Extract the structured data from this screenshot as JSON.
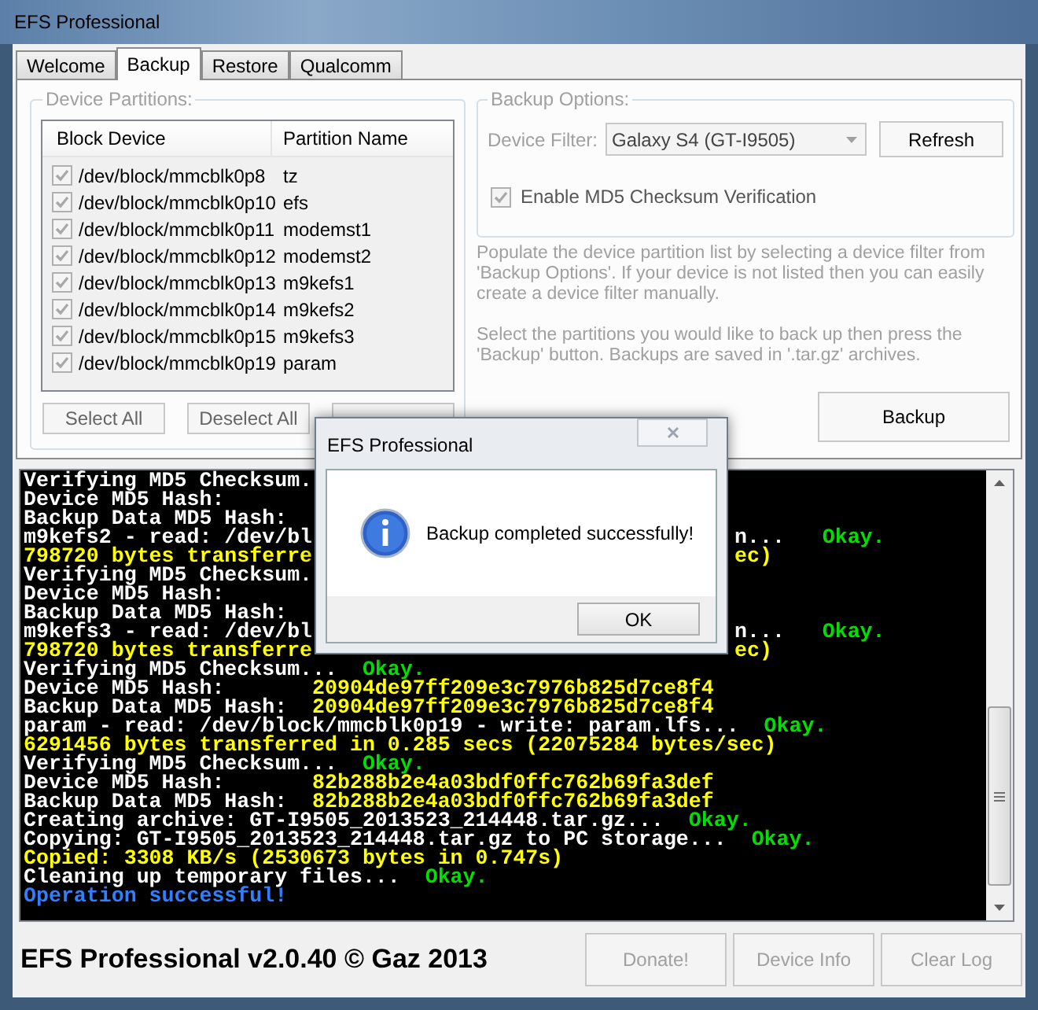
{
  "window": {
    "title": "EFS Professional"
  },
  "tabs": [
    {
      "label": "Welcome",
      "selected": false
    },
    {
      "label": "Backup",
      "selected": true
    },
    {
      "label": "Restore",
      "selected": false
    },
    {
      "label": "Qualcomm",
      "selected": false
    }
  ],
  "partitions": {
    "title": "Device Partitions:",
    "columns": [
      "Block Device",
      "Partition Name"
    ],
    "rows": [
      {
        "device": "/dev/block/mmcblk0p8",
        "name": "tz",
        "checked": true
      },
      {
        "device": "/dev/block/mmcblk0p10",
        "name": "efs",
        "checked": true
      },
      {
        "device": "/dev/block/mmcblk0p11",
        "name": "modemst1",
        "checked": true
      },
      {
        "device": "/dev/block/mmcblk0p12",
        "name": "modemst2",
        "checked": true
      },
      {
        "device": "/dev/block/mmcblk0p13",
        "name": "m9kefs1",
        "checked": true
      },
      {
        "device": "/dev/block/mmcblk0p14",
        "name": "m9kefs2",
        "checked": true
      },
      {
        "device": "/dev/block/mmcblk0p15",
        "name": "m9kefs3",
        "checked": true
      },
      {
        "device": "/dev/block/mmcblk0p19",
        "name": "param",
        "checked": true
      }
    ],
    "buttons": [
      "Select All",
      "Deselect All"
    ]
  },
  "backup_options": {
    "title": "Backup Options:",
    "filter_label": "Device Filter:",
    "filter_value": "Galaxy S4 (GT-I9505)",
    "refresh": "Refresh",
    "md5": {
      "label": "Enable MD5 Checksum Verification",
      "checked": true,
      "disabled": true
    }
  },
  "help": [
    "Populate the device partition list by selecting a device filter from 'Backup Options'. If your device is not listed then you can easily create a device filter manually.",
    "Select the partitions you would like to back up then press the 'Backup' button. Backups are saved in '.tar.gz' archives."
  ],
  "backup_button": "Backup",
  "log": [
    {
      "segments": [
        {
          "text": "Verifying MD5 Checksum.",
          "color": "#ffffff"
        }
      ]
    },
    {
      "segments": [
        {
          "text": "Device MD5 Hash:",
          "color": "#ffffff"
        }
      ]
    },
    {
      "segments": [
        {
          "text": "Backup Data MD5 Hash:",
          "color": "#ffffff"
        }
      ]
    },
    {
      "segments": [
        {
          "text": "m9kefs2 - read: /dev/bl",
          "color": "#ffffff"
        }
      ],
      "tail": [
        {
          "text": "n...   ",
          "color": "#ffffff"
        },
        {
          "text": "Okay.",
          "color": "#00e000"
        }
      ]
    },
    {
      "segments": [
        {
          "text": "798720 bytes transferre",
          "color": "#ffff00"
        }
      ],
      "tail": [
        {
          "text": "ec)",
          "color": "#ffff00"
        }
      ]
    },
    {
      "segments": [
        {
          "text": "Verifying MD5 Checksum.",
          "color": "#ffffff"
        }
      ]
    },
    {
      "segments": [
        {
          "text": "Device MD5 Hash:",
          "color": "#ffffff"
        }
      ]
    },
    {
      "segments": [
        {
          "text": "Backup Data MD5 Hash:",
          "color": "#ffffff"
        }
      ]
    },
    {
      "segments": [
        {
          "text": "m9kefs3 - read: /dev/bl",
          "color": "#ffffff"
        }
      ],
      "tail": [
        {
          "text": "n...   ",
          "color": "#ffffff"
        },
        {
          "text": "Okay.",
          "color": "#00e000"
        }
      ]
    },
    {
      "segments": [
        {
          "text": "798720 bytes transferre",
          "color": "#ffff00"
        }
      ],
      "tail": [
        {
          "text": "ec)",
          "color": "#ffff00"
        }
      ]
    },
    {
      "segments": [
        {
          "text": "Verifying MD5 Checksum...  ",
          "color": "#ffffff"
        },
        {
          "text": "Okay.",
          "color": "#00e000"
        }
      ]
    },
    {
      "segments": [
        {
          "text": "Device MD5 Hash:       ",
          "color": "#ffffff"
        },
        {
          "text": "20904de97ff209e3c7976b825d7ce8f4",
          "color": "#ffff00"
        }
      ]
    },
    {
      "segments": [
        {
          "text": "Backup Data MD5 Hash:  ",
          "color": "#ffffff"
        },
        {
          "text": "20904de97ff209e3c7976b825d7ce8f4",
          "color": "#ffff00"
        }
      ]
    },
    {
      "segments": [
        {
          "text": "param - read: /dev/block/mmcblk0p19 - write: param.lfs...  ",
          "color": "#ffffff"
        },
        {
          "text": "Okay.",
          "color": "#00e000"
        }
      ]
    },
    {
      "segments": [
        {
          "text": "6291456 bytes transferred in 0.285 secs (22075284 bytes/sec)",
          "color": "#ffff00"
        }
      ]
    },
    {
      "segments": [
        {
          "text": "Verifying MD5 Checksum...  ",
          "color": "#ffffff"
        },
        {
          "text": "Okay.",
          "color": "#00e000"
        }
      ]
    },
    {
      "segments": [
        {
          "text": "Device MD5 Hash:       ",
          "color": "#ffffff"
        },
        {
          "text": "82b288b2e4a03bdf0ffc762b69fa3def",
          "color": "#ffff00"
        }
      ]
    },
    {
      "segments": [
        {
          "text": "Backup Data MD5 Hash:  ",
          "color": "#ffffff"
        },
        {
          "text": "82b288b2e4a03bdf0ffc762b69fa3def",
          "color": "#ffff00"
        }
      ]
    },
    {
      "segments": [
        {
          "text": "Creating archive: GT-I9505_2013523_214448.tar.gz...  ",
          "color": "#ffffff"
        },
        {
          "text": "Okay.",
          "color": "#00e000"
        }
      ]
    },
    {
      "segments": [
        {
          "text": "Copying: GT-I9505_2013523_214448.tar.gz to PC storage...  ",
          "color": "#ffffff"
        },
        {
          "text": "Okay.",
          "color": "#00e000"
        }
      ]
    },
    {
      "segments": [
        {
          "text": "Copied: 3308 KB/s (2530673 bytes in 0.747s)",
          "color": "#ffff00"
        }
      ]
    },
    {
      "segments": [
        {
          "text": "Cleaning up temporary files...  ",
          "color": "#ffffff"
        },
        {
          "text": "Okay.",
          "color": "#00e000"
        }
      ]
    },
    {
      "segments": [
        {
          "text": "Operation successful!",
          "color": "#2f7fff"
        }
      ]
    }
  ],
  "dialog": {
    "title": "EFS Professional",
    "message": "Backup completed successfully!",
    "button": "OK"
  },
  "footer": {
    "credit": "EFS Professional v2.0.40 © Gaz 2013",
    "buttons": [
      {
        "label": "Donate!",
        "disabled": true
      },
      {
        "label": "Device Info",
        "disabled": true
      },
      {
        "label": "Clear Log",
        "disabled": true
      }
    ]
  }
}
